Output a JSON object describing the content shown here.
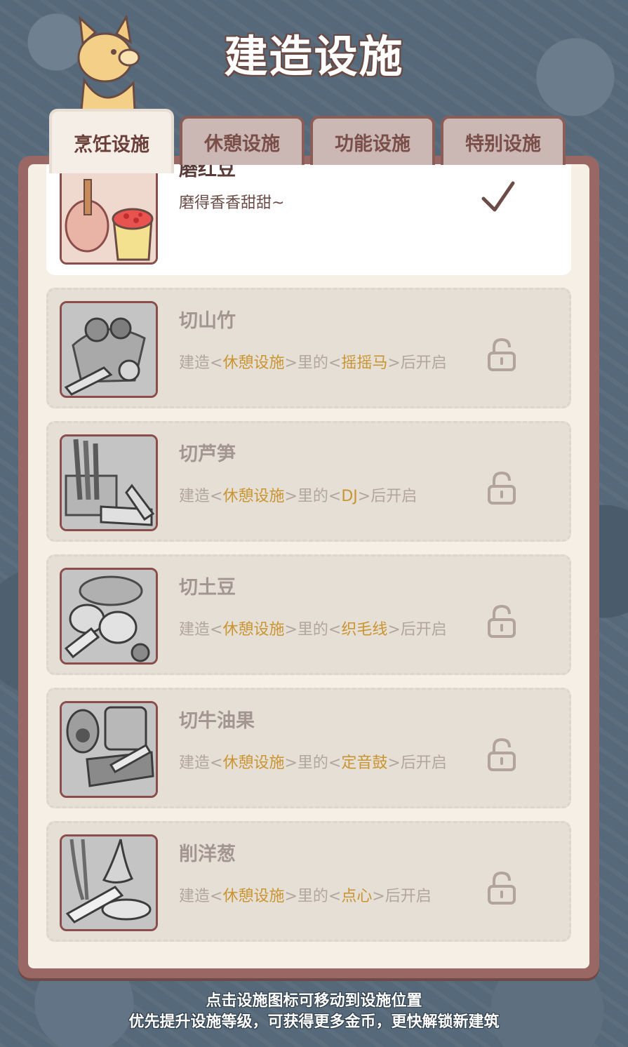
{
  "header": {
    "title": "建造设施"
  },
  "tabs": [
    {
      "label": "烹饪设施",
      "active": true
    },
    {
      "label": "休憩设施",
      "active": false
    },
    {
      "label": "功能设施",
      "active": false
    },
    {
      "label": "特别设施",
      "active": false
    }
  ],
  "facilities": [
    {
      "name": "磨红豆",
      "desc": "磨得香香甜甜~",
      "status": "built",
      "status_icon": "check-icon"
    },
    {
      "name": "切山竹",
      "desc_prefix": "建造<",
      "category": "休憩设施",
      "desc_mid": ">里的<",
      "requirement": "摇摇马",
      "desc_suffix": ">后开启",
      "status": "locked",
      "status_icon": "lock-icon"
    },
    {
      "name": "切芦笋",
      "desc_prefix": "建造<",
      "category": "休憩设施",
      "desc_mid": ">里的<",
      "requirement": "DJ",
      "desc_suffix": ">后开启",
      "status": "locked",
      "status_icon": "lock-icon"
    },
    {
      "name": "切土豆",
      "desc_prefix": "建造<",
      "category": "休憩设施",
      "desc_mid": ">里的<",
      "requirement": "织毛线",
      "desc_suffix": ">后开启",
      "status": "locked",
      "status_icon": "lock-icon"
    },
    {
      "name": "切牛油果",
      "desc_prefix": "建造<",
      "category": "休憩设施",
      "desc_mid": ">里的<",
      "requirement": "定音鼓",
      "desc_suffix": ">后开启",
      "status": "locked",
      "status_icon": "lock-icon"
    },
    {
      "name": "削洋葱",
      "desc_prefix": "建造<",
      "category": "休憩设施",
      "desc_mid": ">里的<",
      "requirement": "点心",
      "desc_suffix": ">后开启",
      "status": "locked",
      "status_icon": "lock-icon"
    }
  ],
  "footer": {
    "line1": "点击设施图标可移动到设施位置",
    "line2": "优先提升设施等级，可获得更多金币，更快解锁新建筑"
  },
  "colors": {
    "background": "#56697a",
    "panel_frame": "#9a6864",
    "panel_fill": "#f5efe6",
    "highlight": "#c99532"
  }
}
